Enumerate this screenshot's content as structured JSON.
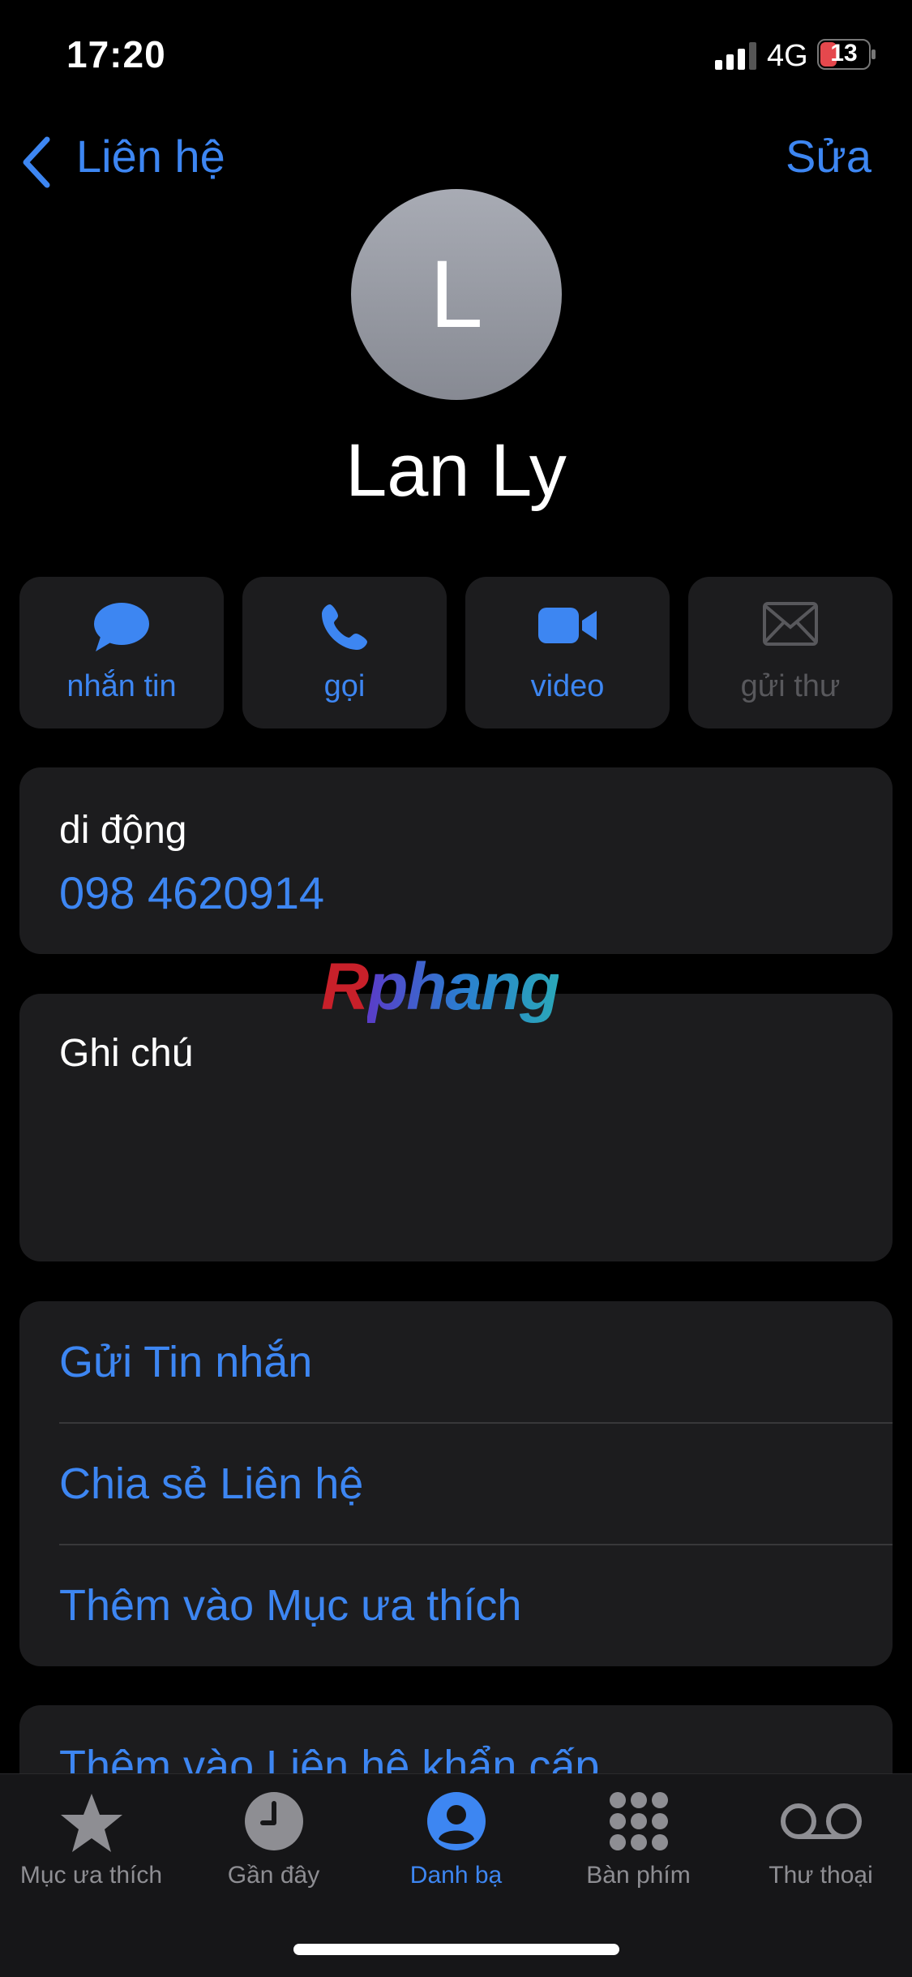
{
  "status": {
    "time": "17:20",
    "network": "4G",
    "battery": "13"
  },
  "nav": {
    "back_label": "Liên hệ",
    "edit_label": "Sửa"
  },
  "contact": {
    "initial": "L",
    "name": "Lan Ly"
  },
  "actions": [
    {
      "label": "nhắn tin",
      "icon": "message-bubble-icon"
    },
    {
      "label": "gọi",
      "icon": "phone-icon"
    },
    {
      "label": "video",
      "icon": "video-camera-icon"
    },
    {
      "label": "gửi thư",
      "icon": "mail-envelope-icon",
      "disabled": true
    }
  ],
  "phone": {
    "type": "di động",
    "number": "098 4620914"
  },
  "notes": {
    "label": "Ghi chú"
  },
  "options": [
    "Gửi Tin nhắn",
    "Chia sẻ Liên hệ",
    "Thêm vào Mục ưa thích"
  ],
  "extra_option": "Thêm vào Liên hệ khẩn cấp",
  "watermark": "Rphang",
  "tabs": [
    {
      "label": "Mục ưa thích",
      "icon": "star-icon"
    },
    {
      "label": "Gần đây",
      "icon": "clock-icon"
    },
    {
      "label": "Danh bạ",
      "icon": "person-circle-icon",
      "active": true
    },
    {
      "label": "Bàn phím",
      "icon": "keypad-icon"
    },
    {
      "label": "Thư thoại",
      "icon": "voicemail-icon"
    }
  ],
  "colors": {
    "accent": "#3d86f2",
    "card": "#1c1c1e",
    "battery_low": "#e5484d"
  }
}
